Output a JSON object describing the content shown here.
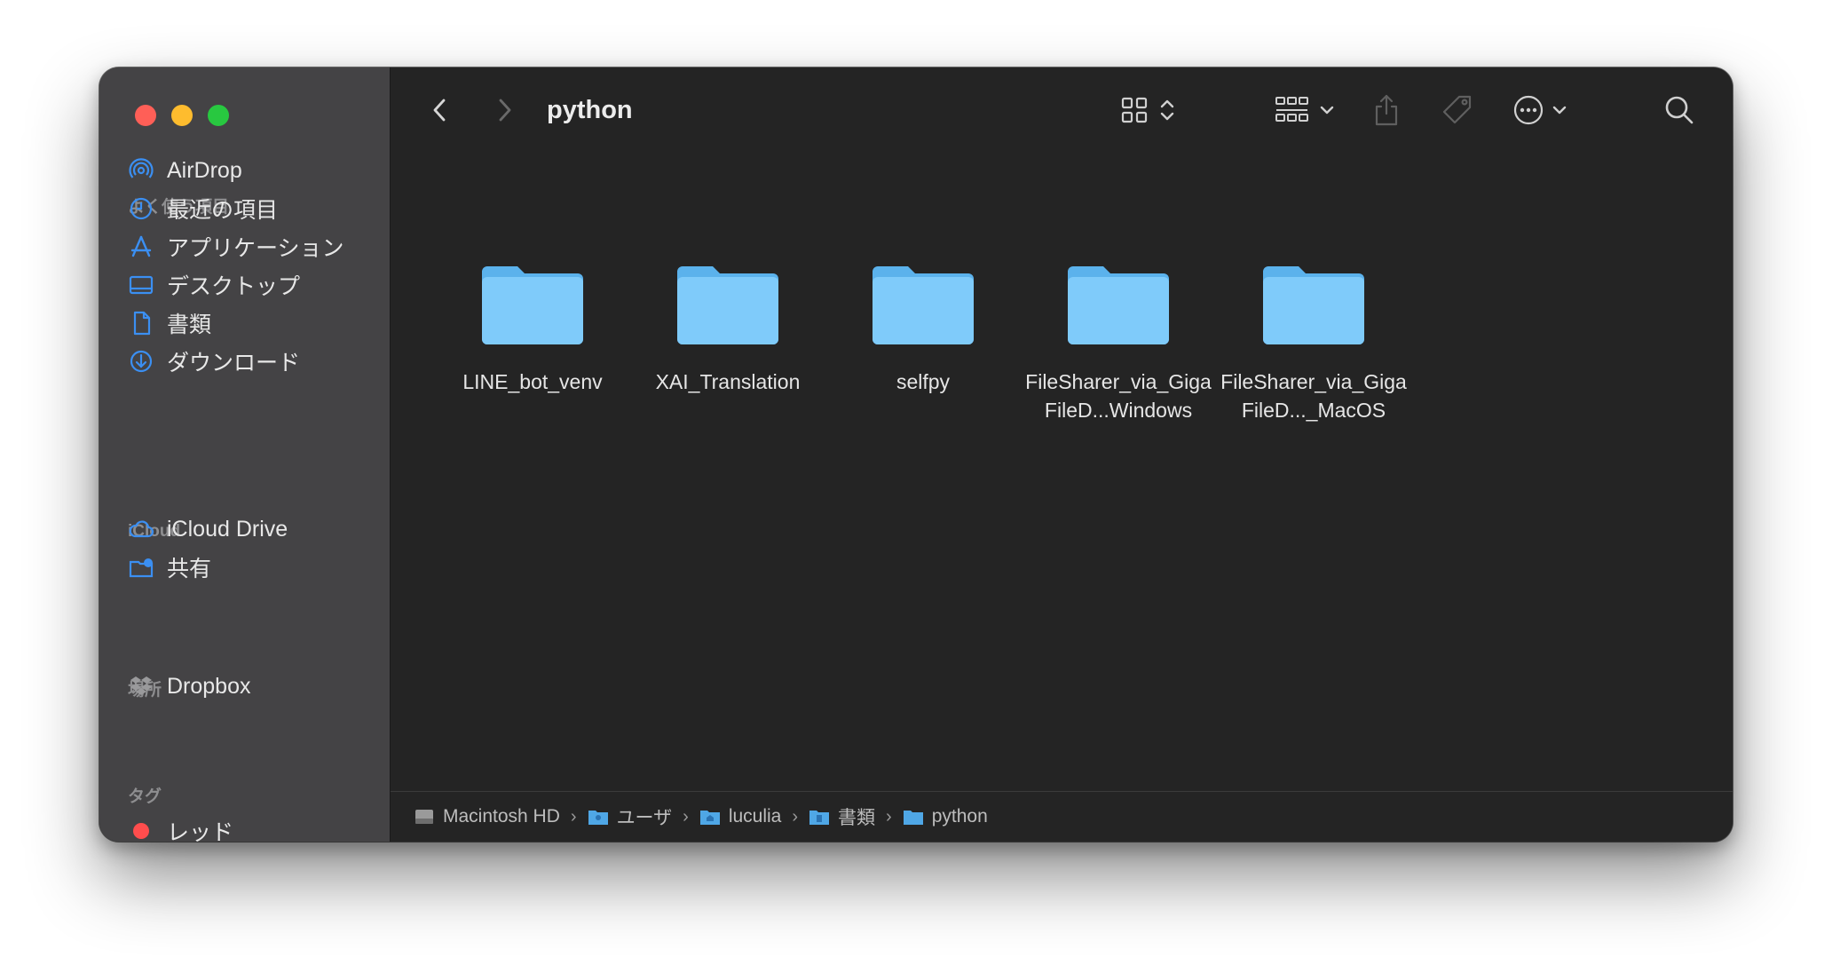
{
  "window": {
    "title": "python"
  },
  "sidebar": {
    "sections": [
      {
        "label": "よく使う項目"
      },
      {
        "label": "iCloud"
      },
      {
        "label": "場所"
      },
      {
        "label": "タグ"
      }
    ],
    "favorites": [
      {
        "label": "AirDrop",
        "icon": "airdrop-icon"
      },
      {
        "label": "最近の項目",
        "icon": "clock-icon"
      },
      {
        "label": "アプリケーション",
        "icon": "applications-icon"
      },
      {
        "label": "デスクトップ",
        "icon": "desktop-icon"
      },
      {
        "label": "書類",
        "icon": "document-icon"
      },
      {
        "label": "ダウンロード",
        "icon": "download-icon"
      }
    ],
    "icloud": [
      {
        "label": "iCloud Drive",
        "icon": "cloud-icon"
      },
      {
        "label": "共有",
        "icon": "shared-folder-icon"
      }
    ],
    "locations": [
      {
        "label": "Dropbox",
        "icon": "dropbox-icon"
      }
    ],
    "tags": [
      {
        "label": "レッド",
        "color": "#ff4d4d"
      }
    ]
  },
  "folders": [
    {
      "name": "LINE_bot_venv"
    },
    {
      "name": "XAI_Translation"
    },
    {
      "name": "selfpy"
    },
    {
      "name": "FileSharer_via_GigaFileD...Windows"
    },
    {
      "name": "FileSharer_via_GigaFileD..._MacOS"
    }
  ],
  "pathbar": [
    {
      "label": "Macintosh HD",
      "icon": "hard-drive-icon"
    },
    {
      "label": "ユーザ",
      "icon": "users-folder-icon"
    },
    {
      "label": "luculia",
      "icon": "home-folder-icon"
    },
    {
      "label": "書類",
      "icon": "documents-folder-icon"
    },
    {
      "label": "python",
      "icon": "folder-icon"
    }
  ],
  "colors": {
    "accent": "#3b8ff2",
    "folder": "#6cc4f8"
  }
}
